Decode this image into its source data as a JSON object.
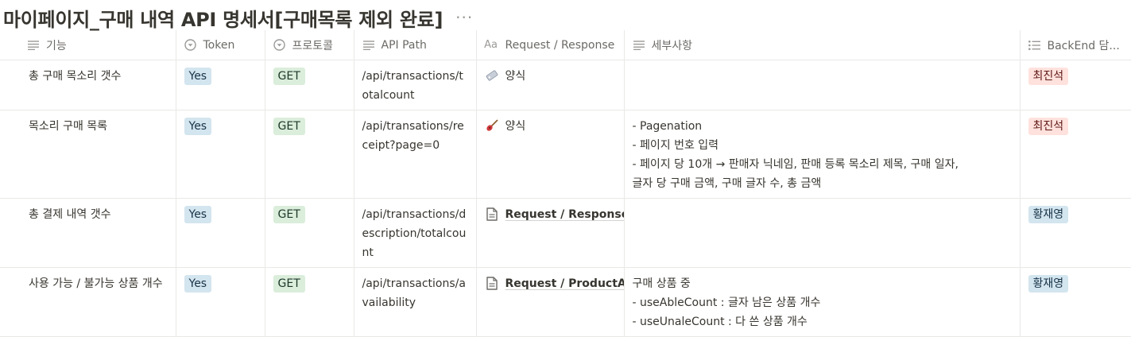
{
  "page": {
    "title": "마이페이지_구매 내역 API 명세서[구매목록 제외 완료]",
    "more_label": "···"
  },
  "columns": {
    "name": "기능",
    "token": "Token",
    "method": "프로토콜",
    "path": "API Path",
    "reqres": "Request / Response",
    "detail": "세부사항",
    "backend": "BackEnd 담..."
  },
  "rows": [
    {
      "name": "총 구매 목소리 갯수",
      "token": "Yes",
      "method": "GET",
      "path": "/api/transactions/totalcount",
      "reqres": "양식",
      "reqres_icon": "tag-icon",
      "detail": [],
      "backend": "최진석",
      "backend_color": "#ffe2dd"
    },
    {
      "name": "목소리 구매 목록",
      "token": "Yes",
      "method": "GET",
      "path": "/api/transations/receipt?page=0",
      "reqres": "양식",
      "reqres_icon": "guitar-icon",
      "detail": [
        "- Pagenation",
        "- 페이지 번호 입력",
        "- 페이지 당 10개 → 판매자 닉네임, 판매 등록 목소리 제목, 구매 일자,",
        "글자 당 구매 금액, 구매 글자 수, 총 금액"
      ],
      "backend": "최진석",
      "backend_color": "#ffe2dd"
    },
    {
      "name": "총 결제 내역 갯수",
      "token": "Yes",
      "method": "GET",
      "path": "/api/transactions/description/totalcount",
      "reqres": "Request / Response",
      "reqres_icon": "document-icon",
      "detail": [],
      "backend": "황재영",
      "backend_color": "#d3e5ef"
    },
    {
      "name": "사용 가능 / 불가능 상품 개수",
      "token": "Yes",
      "method": "GET",
      "path": "/api/transactions/availability",
      "reqres": "Request / ProductAva",
      "reqres_icon": "document-icon",
      "detail": [
        "구매 상품 중",
        "- useAbleCount : 글자 남은 상품 개수",
        "- useUnaleCount : 다 쓴 상품 개수"
      ],
      "backend": "황재영",
      "backend_color": "#d3e5ef"
    }
  ]
}
